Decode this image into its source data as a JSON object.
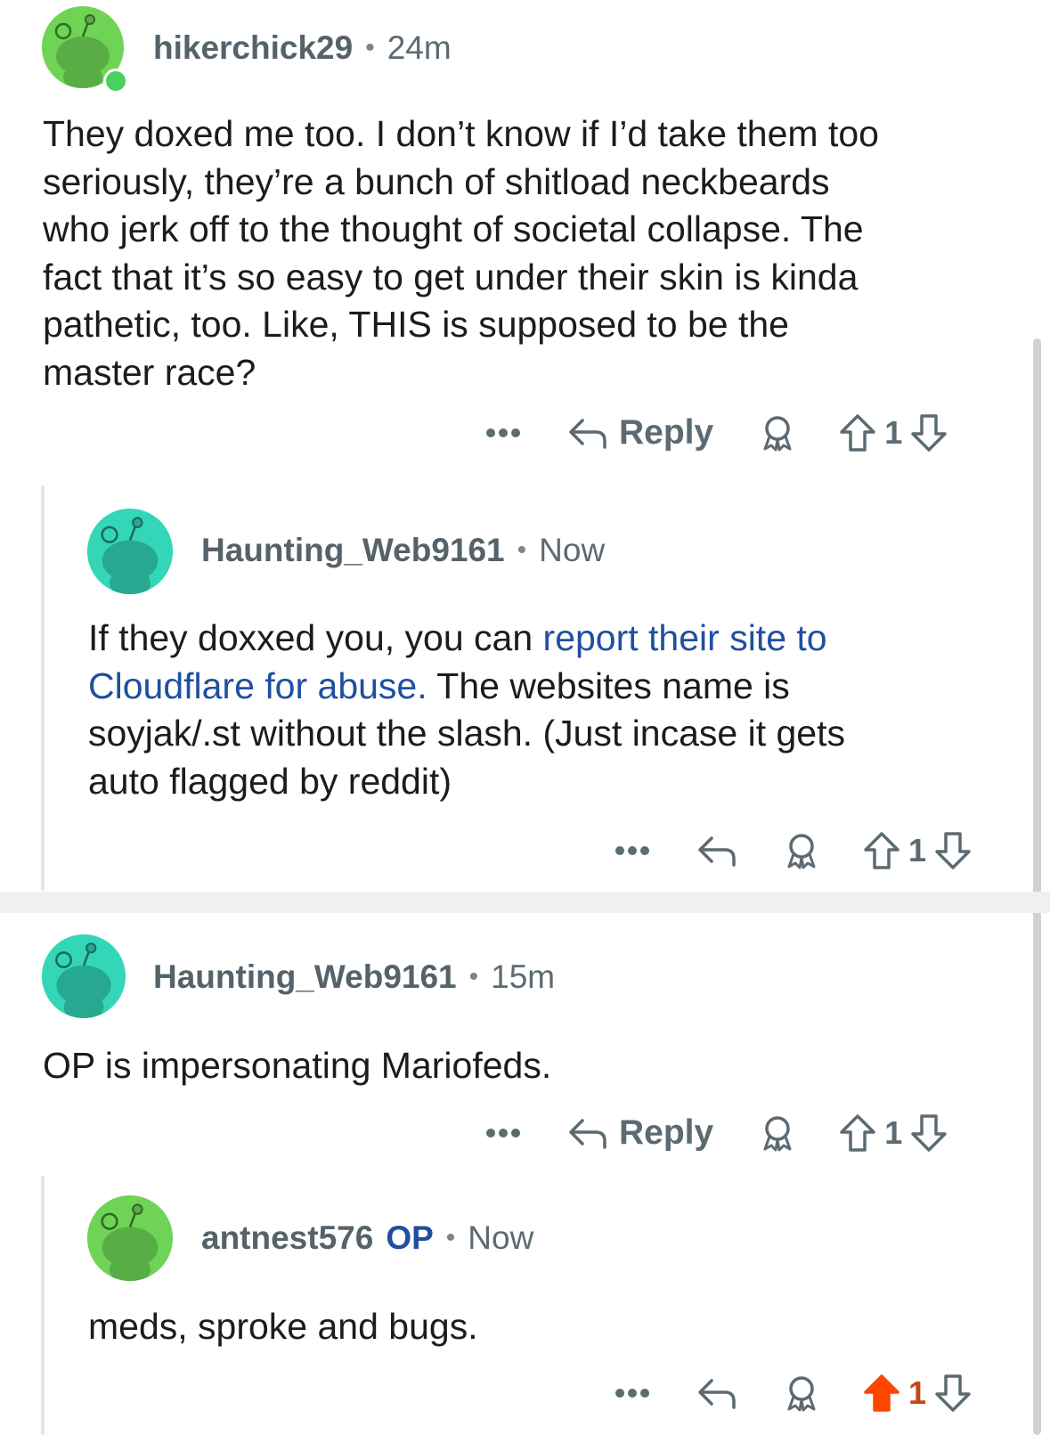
{
  "comments": [
    {
      "username": "hikerchick29",
      "time": "24m",
      "online": true,
      "avatar_color": "#6fd455",
      "lines": [
        "They doxed me too.  I don’t know if I’d take them too",
        "seriously, they’re a bunch of shitload neckbeards",
        "who jerk off to the thought of societal collapse.  The",
        "fact that it’s so easy to get under their skin is kinda",
        "pathetic, too.  Like, THIS is supposed to be the",
        "master race?"
      ],
      "actions": {
        "more_icon": "more-icon",
        "reply_label": "Reply",
        "award_icon": "award-icon",
        "upvote_icon": "upvote-icon",
        "score": "1",
        "downvote_icon": "downvote-icon"
      }
    },
    {
      "username": "Haunting_Web9161",
      "time": "Now",
      "avatar_color": "#34d6b8",
      "text_before_link": "If they doxxed you, you can ",
      "link_text_1": "report their site to",
      "link_text_2": "Cloudflare for abuse.",
      "text_after_link": " The websites name is",
      "lines_rest": [
        "soyjak/.st without the slash. (Just incase it gets",
        "auto flagged by reddit)"
      ],
      "actions": {
        "score": "1"
      }
    },
    {
      "username": "Haunting_Web9161",
      "time": "15m",
      "avatar_color": "#34d6b8",
      "lines": [
        "OP is impersonating Mariofeds."
      ],
      "actions": {
        "reply_label": "Reply",
        "score": "1"
      }
    },
    {
      "username": "antnest576",
      "op_badge": "OP",
      "time": "Now",
      "avatar_color": "#6fd455",
      "lines": [
        "meds, sproke and bugs."
      ],
      "actions": {
        "score": "1",
        "upvoted": true,
        "upvote_color": "#ff4500"
      }
    }
  ],
  "colors": {
    "link": "#1f4fa0",
    "meta_text": "#5c6a72",
    "upvote_active": "#ff4500",
    "online_dot": "#46d160"
  }
}
